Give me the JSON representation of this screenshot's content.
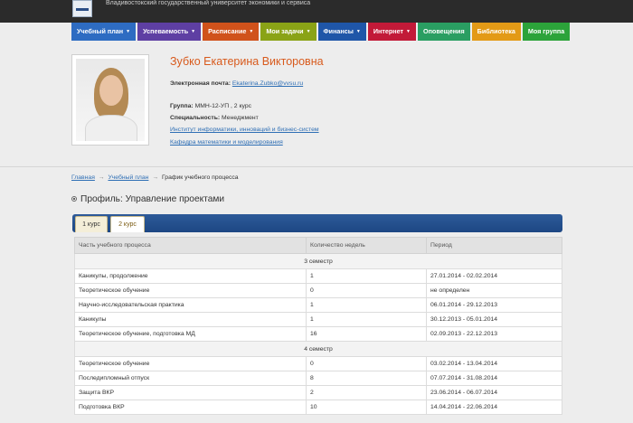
{
  "header": {
    "university": "Владивостокский государственный университет экономики и сервиса",
    "logo_icon": "university-logo-icon"
  },
  "nav": [
    {
      "label": "Учебный план",
      "caret": "▼",
      "color": "#2e6cc2"
    },
    {
      "label": "Успеваемость",
      "caret": "▼",
      "color": "#5e3fa3"
    },
    {
      "label": "Расписание",
      "caret": "▼",
      "color": "#d0521b"
    },
    {
      "label": "Мои задачи",
      "caret": "▼",
      "color": "#8aa316"
    },
    {
      "label": "Финансы",
      "caret": "▼",
      "color": "#1f56a8"
    },
    {
      "label": "Интернет",
      "caret": "▼",
      "color": "#c21a38"
    },
    {
      "label": "Оповещения",
      "caret": "",
      "color": "#2a9e62"
    },
    {
      "label": "Библиотека",
      "caret": "",
      "color": "#e39a16"
    },
    {
      "label": "Моя группа",
      "caret": "",
      "color": "#2ca33a"
    }
  ],
  "profile": {
    "name": "Зубко Екатерина Викторовна",
    "email_label": "Электронная почта:",
    "email": "Ekaterina.Zubko@vvsu.ru",
    "group_label": "Группа:",
    "group": "ММН-12-УП , 2 курс",
    "specialty_label": "Специальность:",
    "specialty": "Менеджмент",
    "institute": "Институт информатики, инноваций и бизнес-систем",
    "department": "Кафедра математики и моделирования"
  },
  "breadcrumbs": {
    "home": "Главная",
    "plan": "Учебный план",
    "current": "График учебного процесса",
    "arrow": "→"
  },
  "section_title": "Профиль: Управление проектами",
  "tabs": [
    "1 курс",
    "2 курс"
  ],
  "table": {
    "headers": [
      "Часть учебного процесса",
      "Количество недель",
      "Период"
    ],
    "semesters": [
      {
        "title": "3 семестр",
        "rows": [
          [
            "Каникулы, продолжение",
            "1",
            "27.01.2014 - 02.02.2014"
          ],
          [
            "Теоретическое обучение",
            "0",
            "не определен"
          ],
          [
            "Научно-исследовательская практика",
            "1",
            "06.01.2014 - 29.12.2013"
          ],
          [
            "Каникулы",
            "1",
            "30.12.2013 - 05.01.2014"
          ],
          [
            "Теоретическое обучение, подготовка МД",
            "16",
            "02.09.2013 - 22.12.2013"
          ]
        ]
      },
      {
        "title": "4 семестр",
        "rows": [
          [
            "Теоретическое обучение",
            "0",
            "03.02.2014 - 13.04.2014"
          ],
          [
            "Последипломный отпуск",
            "8",
            "07.07.2014 - 31.08.2014"
          ],
          [
            "Защита ВКР",
            "2",
            "23.06.2014 - 06.07.2014"
          ],
          [
            "Подготовка ВКР",
            "10",
            "14.04.2014 - 22.06.2014"
          ]
        ]
      }
    ]
  }
}
